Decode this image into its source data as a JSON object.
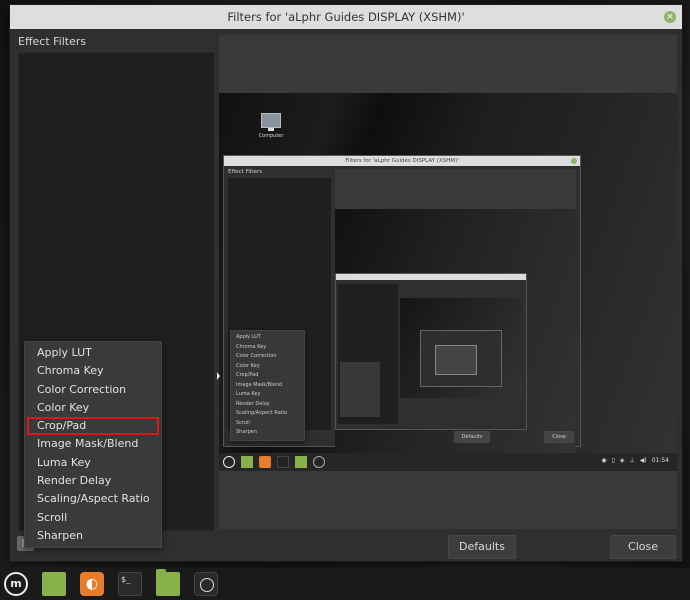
{
  "window": {
    "title": "Filters for 'aLphr Guides DISPLAY (XSHM)'",
    "close_glyph": "×",
    "effect_filters_label": "Effect Filters",
    "defaults_label": "Defaults",
    "close_label": "Close"
  },
  "menu": {
    "items": [
      {
        "label": "Apply LUT"
      },
      {
        "label": "Chroma Key"
      },
      {
        "label": "Color Correction"
      },
      {
        "label": "Color Key"
      },
      {
        "label": "Crop/Pad",
        "highlighted": true
      },
      {
        "label": "Image Mask/Blend"
      },
      {
        "label": "Luma Key"
      },
      {
        "label": "Render Delay"
      },
      {
        "label": "Scaling/Aspect Ratio"
      },
      {
        "label": "Scroll"
      },
      {
        "label": "Sharpen"
      }
    ],
    "highlight_color": "#e0141b"
  },
  "footer_controls": {
    "add_icon": "plus-icon",
    "arrows": "˄ ˅ ▾"
  },
  "preview": {
    "desktop_icon_label": "Computer",
    "nested_window": {
      "title": "Filters for 'aLphr Guides DISPLAY (XSHM)'",
      "effect_filters_label": "Effect Filters",
      "menu_items": [
        "Apply LUT",
        "Chroma Key",
        "Color Correction",
        "Color Key",
        "Crop/Pad",
        "Image Mask/Blend",
        "Luma Key",
        "Render Delay",
        "Scaling/Aspect Ratio",
        "Scroll",
        "Sharpen"
      ],
      "defaults_label": "Defaults",
      "close_label": "Close"
    },
    "tray_clock": "01:54"
  },
  "taskbar": {
    "items": [
      {
        "name": "mint-menu",
        "glyph": "m"
      },
      {
        "name": "files-green",
        "glyph": ""
      },
      {
        "name": "firefox",
        "glyph": "◐"
      },
      {
        "name": "terminal",
        "glyph": "$_"
      },
      {
        "name": "folder",
        "glyph": ""
      },
      {
        "name": "obs",
        "glyph": ""
      }
    ]
  }
}
